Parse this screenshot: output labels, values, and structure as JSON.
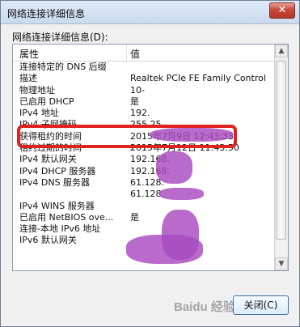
{
  "window": {
    "title": "网络连接详细信息",
    "close_glyph": "✕"
  },
  "details_label": "网络连接详细信息(D):",
  "columns": [
    "属性",
    "值"
  ],
  "rows": [
    {
      "property": "连接特定的 DNS 后缀",
      "value": ""
    },
    {
      "property": "描述",
      "value": "Realtek PCIe FE Family Control"
    },
    {
      "property": "物理地址",
      "value": "10-"
    },
    {
      "property": "已启用 DHCP",
      "value": "是"
    },
    {
      "property": "IPv4 地址",
      "value": "192."
    },
    {
      "property": "IPv4 子网掩码",
      "value": "255.25"
    },
    {
      "property": "获得租约的时间",
      "value": "2015年7月9日 12:43:33"
    },
    {
      "property": "租约过期的时间",
      "value": "2015年7月12日 11:43:50"
    },
    {
      "property": "IPv4 默认网关",
      "value": "192.168."
    },
    {
      "property": "IPv4 DHCP 服务器",
      "value": "192.168."
    },
    {
      "property": "IPv4 DNS 服务器",
      "value": "61.128."
    },
    {
      "property": "",
      "value": "61.128."
    },
    {
      "property": "IPv4 WINS 服务器",
      "value": ""
    },
    {
      "property": "已启用 NetBIOS ove...",
      "value": "是"
    },
    {
      "property": "连接-本地 IPv6 地址",
      "value": ""
    },
    {
      "property": "IPv6 默认网关",
      "value": ""
    }
  ],
  "scrollbar": {
    "up_glyph": "▲",
    "down_glyph": "▼"
  },
  "buttons": {
    "close": "关闭(C)"
  },
  "watermark": "Baidu 经验",
  "colors": {
    "highlight": "#e02121",
    "redaction": "#a84ac0"
  }
}
